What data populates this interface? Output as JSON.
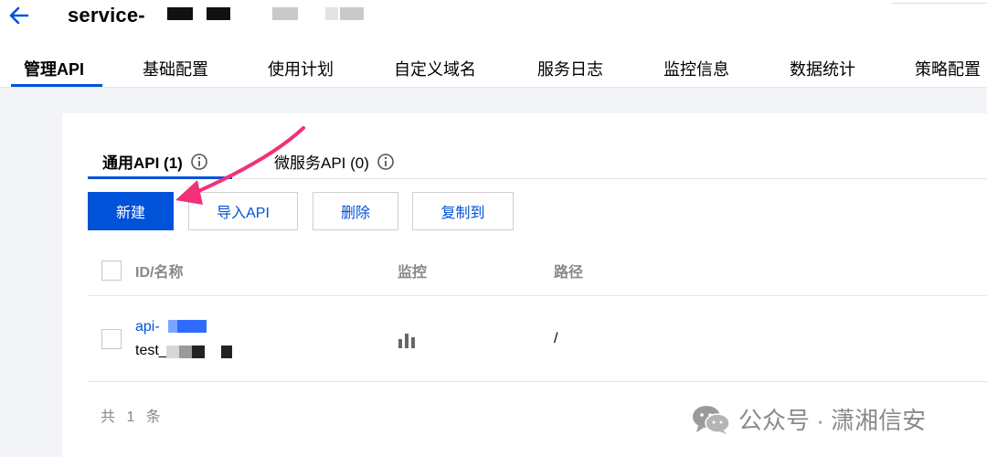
{
  "header": {
    "back_icon": "arrow-left-icon",
    "title": "service-"
  },
  "tabs": [
    {
      "label": "管理API",
      "active": true
    },
    {
      "label": "基础配置"
    },
    {
      "label": "使用计划"
    },
    {
      "label": "自定义域名"
    },
    {
      "label": "服务日志"
    },
    {
      "label": "监控信息"
    },
    {
      "label": "数据统计"
    },
    {
      "label": "策略配置"
    }
  ],
  "subtabs": [
    {
      "label": "通用API (1)",
      "active": true,
      "icon": "info-icon"
    },
    {
      "label": "微服务API (0)",
      "icon": "info-icon"
    }
  ],
  "toolbar": {
    "new_label": "新建",
    "import_label": "导入API",
    "delete_label": "删除",
    "copy_label": "复制到"
  },
  "table": {
    "columns": [
      "ID/名称",
      "监控",
      "路径"
    ],
    "rows": [
      {
        "id": "api-",
        "name": "test_",
        "monitor_icon": "bar-chart-icon",
        "path": "/"
      }
    ]
  },
  "footer": {
    "total": "共 1 条"
  },
  "watermark": {
    "icon": "wechat-icon",
    "text": "公众号 · 潇湘信安"
  },
  "colors": {
    "primary": "#0052d9",
    "annotation_arrow": "#f2317a"
  }
}
